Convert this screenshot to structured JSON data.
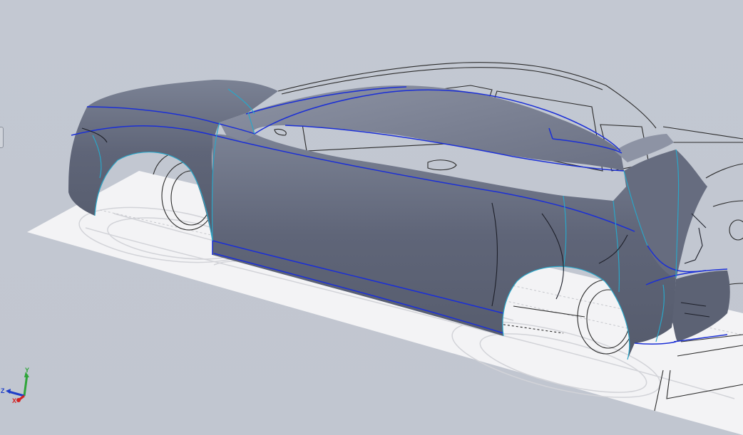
{
  "viewport": {
    "background": "#c3c8d2",
    "model_shading": "#5f6578",
    "edge_color": "#1b2fd6",
    "tangent_edge_color": "#2aa6c8",
    "sketch_line_color": "#2b2b2b",
    "ground_plane_color": "#f4f4f6"
  },
  "triad": {
    "y_label": "Y",
    "z_label": "Z",
    "x_label": "X",
    "y_color": "#2fa53a",
    "z_color": "#1f3ec8",
    "x_color": "#d32222"
  }
}
